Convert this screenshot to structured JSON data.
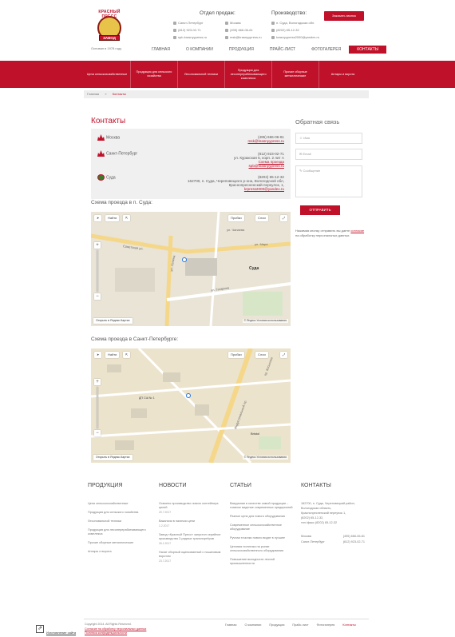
{
  "brand": {
    "logo_text_top": "КРАСНЫЙ ПРЕСС",
    "logo_text_bottom": "ЗАВОД",
    "slogan": "Основан в 1978 году"
  },
  "header": {
    "sales_title": "Отдел продаж:",
    "prod_title": "Производство:",
    "sales_spb_city": "Санкт-Петербург",
    "sales_spb_phone": "(812) 923-02-71",
    "sales_spb_email": "spb-krasnyypress.ru",
    "sales_msk_city": "Москва",
    "sales_msk_phone": "(495) 666-06-81",
    "sales_msk_email": "msk@krasnyypress.ru",
    "prod_city": "п. Суда, Вологодская обл.",
    "prod_phone": "(8202) 65-12-32",
    "prod_email": "krasnyypress2000@yandex.ru",
    "call_button": "Заказать звонок",
    "nav": [
      "ГЛАВНАЯ",
      "О КОМПАНИИ",
      "ПРОДУКЦИЯ",
      "ПРАЙС-ЛИСТ",
      "ФОТОГАЛЕРЕЯ",
      "КОНТАКТЫ"
    ]
  },
  "categories": [
    "Цепи сельскохозяйственные",
    "Продукция для сельского хозяйства",
    "Лесоповальной техники",
    "Продукция для лесоперерабатывающего комплекса",
    "Прочие сборные металлические",
    "Антары и воротa"
  ],
  "breadcrumbs": {
    "home": "Главная",
    "sep": "»",
    "current": "Контакты"
  },
  "contacts": {
    "title": "Контакты",
    "moscow": {
      "city": "Москва",
      "phone": "(495) 666-06-81",
      "email": "msk@krasnyypress.ru"
    },
    "spb": {
      "city": "Санкт-Петербург",
      "phone": "(812) 923-02-71",
      "address": "ул. Куракская 5, корп. 2 лит А",
      "scheme": "Схема проезда",
      "email": "spb@krasnyypress.ru"
    },
    "suda": {
      "city": "Суда",
      "phone": "(8202) 65-12-32",
      "address1": "162700, п. Суда, Череповецкого р-она, Вологодской обл,",
      "address2": "Краснопресненский переулок, 1,",
      "email": "krpress2000@yandex.ru"
    }
  },
  "maps": {
    "suda_title": "Схема проезда в п. Суда:",
    "spb_title": "Схема проезда в Санкт-Петербурге:",
    "find_btn": "Найти",
    "traffic_btn": "Пробки",
    "layers_btn": "Слои",
    "open_yandex": "Открыть в Яндекс.Картах",
    "copyright": "© Яндекс  Условия использования",
    "suda_labels": [
      "Советская ул.",
      "ул. Ленина",
      "ул. Гагарина",
      "Суда",
      "ул. Мира",
      "ул. Чапаева"
    ],
    "spb_labels": [
      "Индустриальный пр.",
      "пр. Косыгина",
      "Bristol",
      "ДП СШ № 1"
    ]
  },
  "form": {
    "title": "Обратная связь",
    "name_ph": "Имя",
    "email_ph": "Email",
    "message_ph": "Сообщение",
    "send": "ОТПРАВИТЬ",
    "note_before": "Нажимая кнопку отправить вы даете ",
    "note_link": "согласие",
    "note_after": " на обработку персональных данных"
  },
  "footer": {
    "products_title": "ПРОДУКЦИЯ",
    "products": [
      "Цепи сельскохозяйственные",
      "Продукция для сельского хозяйства",
      "Лесоповальной техники",
      "Продукция для лесоперерабатывающего комплекса",
      "Прочие сборные металлические",
      "Антары и воротa"
    ],
    "news_title": "НОВОСТИ",
    "news": [
      {
        "text": "Освоено производство нового контейнера цепей",
        "date": "20.7.2017"
      },
      {
        "text": "Вакансии в наличии цепи",
        "date": "1.2.2017"
      },
      {
        "text": "Завод «Красный Пресс» запустил серийное производство 2-рядных транспортёров",
        "date": "26.1.2017"
      },
      {
        "text": "Начат сборный оцинкованный с пошаговым воротом",
        "date": "23.7.2017"
      }
    ],
    "articles_title": "СТАТЬИ",
    "articles": [
      "Вакуумная в качестве самой продукции – главное видение современных предприятий",
      "Разные цепи для нового оборудования",
      "Современное сельскохозяйственное оборудование",
      "Ручная точилки нового видят в лучшее",
      "Ценовая политика на рынке сельскохозяйственного оборудования",
      "Повышение выгодности лесной промышленности"
    ],
    "contacts_title": "КОНТАКТЫ",
    "contacts_addr": [
      "162700, п. Суда, Череповецкий район,",
      "Вологодская область,",
      "Краснопресненский переулок 1,",
      "(8202) 65-12-32,",
      "тел./факс (8202) 65-12-32"
    ],
    "contacts_rows": [
      {
        "city": "Москва",
        "phone": "(495) 666-06-81"
      },
      {
        "city": "Санкт-Петербург",
        "phone": "(812) 923-02-71"
      }
    ],
    "copyright": "Copyright 2014. All Rights Reserved.",
    "copyright_link": "Согласие на обработку персональных данных",
    "privacy_link": "Политика конфиденциальности",
    "dev_link": "Изготовление сайта",
    "menu": [
      "Главная",
      "О компании",
      "Продукция",
      "Прайс-лист",
      "Фотогалерея",
      "Контакты"
    ]
  }
}
